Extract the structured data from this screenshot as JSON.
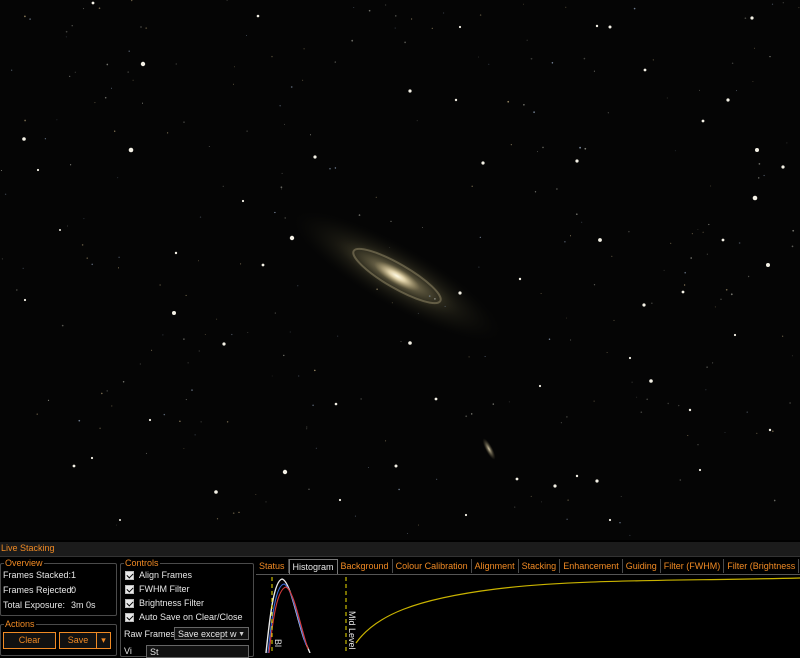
{
  "panel": {
    "title": "Live Stacking"
  },
  "overview": {
    "label": "Overview",
    "rows": [
      {
        "name": "Frames Stacked:",
        "value": "1"
      },
      {
        "name": "Frames Rejected:",
        "value": "0"
      },
      {
        "name": "Total Exposure:",
        "value": "3m 0s"
      }
    ]
  },
  "actions": {
    "label": "Actions",
    "clear": "Clear",
    "save": "Save",
    "save_arrow": "▾"
  },
  "controls": {
    "label": "Controls",
    "checks": [
      "Align Frames",
      "FWHM Filter",
      "Brightness Filter",
      "Auto Save on Clear/Close"
    ],
    "raw_frames_label": "Raw Frames",
    "raw_frames_value": "Save except w",
    "view_label": "Vi",
    "view_value": "St"
  },
  "tabs": [
    "Status",
    "Histogram",
    "Background",
    "Colour Calibration",
    "Alignment",
    "Stacking",
    "Enhancement",
    "Guiding",
    "Filter (FWHM)",
    "Filter (Brightness"
  ],
  "active_tab": "Histogram",
  "histogram": {
    "black_label": "Bl",
    "mid_label": "Mid Level"
  },
  "colors": {
    "accent": "#f08a24",
    "curve": "#c9b300"
  }
}
